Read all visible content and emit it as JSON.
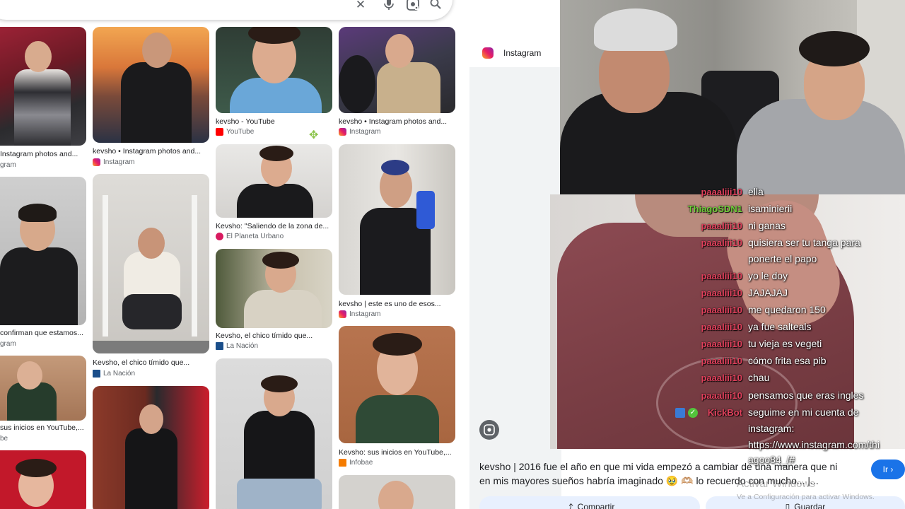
{
  "search": {
    "icons": [
      "close-icon",
      "mic-icon",
      "lens-icon",
      "search-icon"
    ]
  },
  "tiles": [
    {
      "caption": "Instagram photos and...",
      "source": "gram",
      "fav": "none"
    },
    {
      "caption": "kevsho • Instagram photos and...",
      "source": "Instagram",
      "fav": "ig"
    },
    {
      "caption": "kevsho - YouTube",
      "source": "YouTube",
      "fav": "yt"
    },
    {
      "caption": "kevsho • Instagram photos and...",
      "source": "Instagram",
      "fav": "ig"
    },
    {
      "caption": "confirman que estamos...",
      "source": "gram",
      "fav": "none"
    },
    {
      "caption": "Kevsho, el chico tímido que...",
      "source": "La Nación",
      "fav": "ln"
    },
    {
      "caption": "Kevsho: \"Saliendo de la zona de...",
      "source": "El Planeta Urbano",
      "fav": "pu"
    },
    {
      "caption": "kevsho | este es uno de esos...",
      "source": "Instagram",
      "fav": "ig"
    },
    {
      "caption": "sus inicios en YouTube,...",
      "source": "be",
      "fav": "none"
    },
    {
      "caption": "Kevsho, el chico tímido que...",
      "source": "La Nación",
      "fav": "ln"
    },
    {
      "caption": "Kevsho: sus inicios en YouTube,...",
      "source": "Infobae",
      "fav": "ib"
    }
  ],
  "panel": {
    "source_name": "Instagram"
  },
  "description": "kevsho | 2016 fue el año en que mi vida empezó a cambiar de una manera que ni en mis mayores sueños habría imaginado 🥹 🫶🏼 lo recuerdo con mucho... |...",
  "buttons": {
    "go": "Ir ›",
    "share": "Compartir",
    "save": "Guardar"
  },
  "windows": {
    "line1": "Activar Windows",
    "line2": "Ve a Configuración para activar Windows."
  },
  "chat": [
    {
      "user": "paaaliii10",
      "msg": "ella",
      "color": "#e0405c"
    },
    {
      "user": "ThiagoSDN1",
      "msg": "isaminierii",
      "color": "#6fcf3a"
    },
    {
      "user": "paaaliii10",
      "msg": "ni ganas",
      "color": "#e0405c"
    },
    {
      "user": "paaaliii10",
      "msg": "quisiera ser tu tanga para",
      "color": "#e0405c"
    },
    {
      "user": "",
      "msg": "ponerte el papo",
      "color": "#e0405c"
    },
    {
      "user": "paaaliii10",
      "msg": "yo le doy",
      "color": "#e0405c"
    },
    {
      "user": "paaaliii10",
      "msg": "JAJAJAJ",
      "color": "#e0405c"
    },
    {
      "user": "paaaliii10",
      "msg": "me quedaron 150",
      "color": "#e0405c"
    },
    {
      "user": "paaaliii10",
      "msg": "ya fue salteals",
      "color": "#e0405c"
    },
    {
      "user": "paaaliii10",
      "msg": "tu vieja es vegeti",
      "color": "#e0405c"
    },
    {
      "user": "paaaliii10",
      "msg": "cómo frita esa pib",
      "color": "#e0405c"
    },
    {
      "user": "paaaliii10",
      "msg": "chau",
      "color": "#e0405c"
    },
    {
      "user": "paaaliii10",
      "msg": "pensamos que eras ingles",
      "color": "#e0405c"
    },
    {
      "user": "KickBot",
      "msg": "seguime en mi cuenta de",
      "color": "#e0405c"
    },
    {
      "user": "",
      "msg": "instagram:",
      "color": "#e0405c"
    },
    {
      "user": "",
      "msg": "https://www.instagram.com/thi",
      "color": "#e0405c"
    },
    {
      "user": "",
      "msg": "agoo84_/#",
      "color": "#e0405c"
    }
  ]
}
